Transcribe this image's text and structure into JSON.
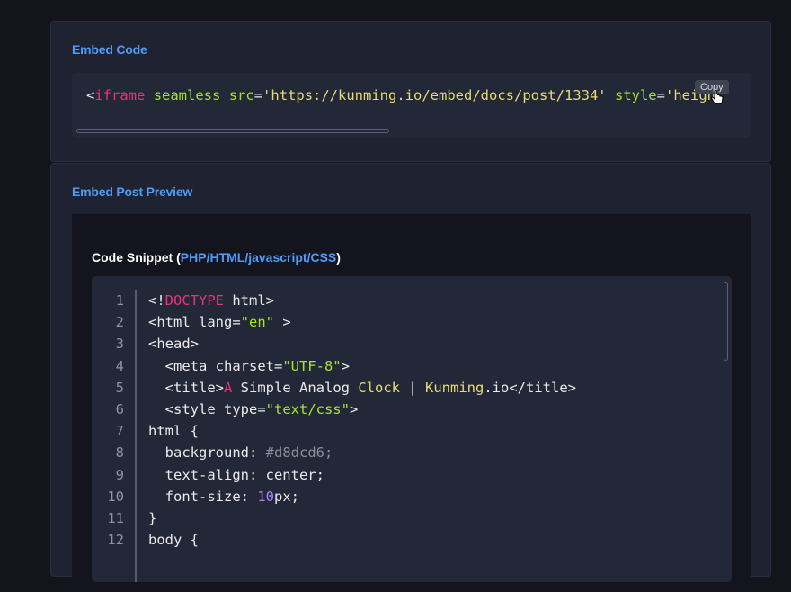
{
  "embed_section": {
    "title": "Embed Code",
    "code": {
      "open": "<",
      "tag": "iframe",
      "attr1": "seamless",
      "attr2": "src",
      "eq": "=",
      "src_value": "'https://kunming.io/embed/docs/post/1334'",
      "attr3": "style",
      "eq2": "=",
      "trail": "'heigh"
    },
    "copy_label": "Copy"
  },
  "preview_section": {
    "title": "Embed Post Preview",
    "snippet_heading_prefix": "Code Snippet (",
    "snippet_languages": "PHP/HTML/javascript/CSS",
    "snippet_heading_suffix": ")"
  },
  "code_lines": {
    "numbers": [
      "1",
      "2",
      "3",
      "4",
      "5",
      "6",
      "7",
      "8",
      "9",
      "10",
      "11",
      "12"
    ],
    "l1": {
      "a": "<!",
      "b": "DOCTYPE",
      "c": " html>"
    },
    "l2": {
      "a": "<html lang=",
      "b": "\"en\"",
      "c": " >"
    },
    "l3": {
      "a": "<head>"
    },
    "l4": {
      "a": "  <meta charset=",
      "b": "\"UTF-8\"",
      "c": ">"
    },
    "l5": {
      "a": "  <title>",
      "b": "A",
      "c": " Simple Analog ",
      "d": "Clock",
      "e": " | ",
      "f": "Kunming",
      "g": ".io</title>"
    },
    "l6": {
      "a": "  <style type=",
      "b": "\"text/css\"",
      "c": ">"
    },
    "l7": {
      "a": "html {"
    },
    "l8": {
      "a": "  background: ",
      "b": "#d8dcd6;"
    },
    "l9": {
      "a": "  text-align: center;"
    },
    "l10": {
      "a": "  font-size: ",
      "b": "10",
      "c": "px;"
    },
    "l11": {
      "a": "}"
    },
    "l12": {
      "a": "body {"
    }
  }
}
